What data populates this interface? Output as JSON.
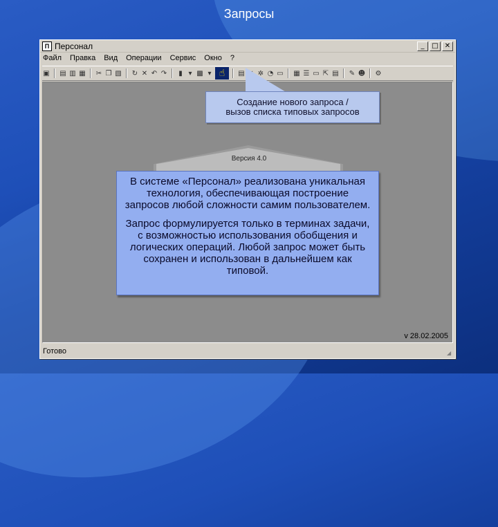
{
  "slide": {
    "title": "Запросы"
  },
  "window": {
    "title": "Персонал",
    "app_icon": "П",
    "controls": {
      "minimize": "_",
      "maximize": "□",
      "close": "✕"
    }
  },
  "menu": [
    "Файл",
    "Правка",
    "Вид",
    "Операции",
    "Сервис",
    "Окно",
    "?"
  ],
  "toolbar": {
    "active_icon": "hand-pointer-icon",
    "active_glyph": "☝"
  },
  "callout": {
    "line1": "Создание нового запроса /",
    "line2": "вызов списка типовых запросов"
  },
  "logo": {
    "version": "Версия 4.0"
  },
  "info": {
    "p1": "В системе «Персонал» реализована уникальная технология, обеспечивающая построение запросов любой сложности самим пользователем.",
    "p2": "Запрос формулируется только в терминах задачи, с возможностью использования обобщения и логических операций. Любой запрос может быть сохранен и использован в дальнейшем как типовой."
  },
  "version_date": "v 28.02.2005",
  "status": {
    "text": "Готово"
  },
  "colors": {
    "background": "#1e4fb8",
    "window": "#d4d0c8",
    "workarea": "#8c8c8c",
    "callout": "#b8c9ee",
    "info": "#93aef0"
  }
}
